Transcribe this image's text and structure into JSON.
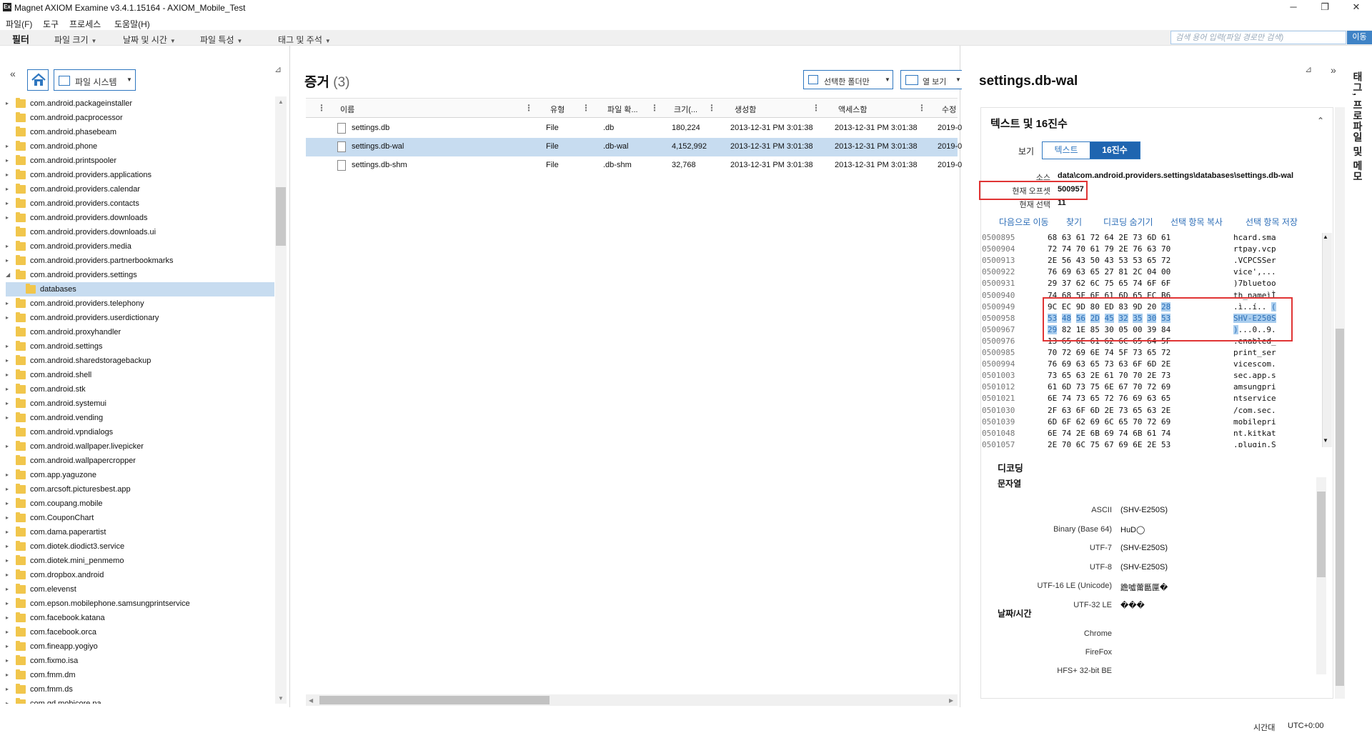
{
  "window": {
    "title": "Magnet AXIOM Examine v3.4.1.15164 - AXIOM_Mobile_Test",
    "app_icon_text": "Ex"
  },
  "menu": [
    "파일(F)",
    "도구",
    "프로세스",
    "도움말(H)"
  ],
  "filter_bar": {
    "label": "필터",
    "dropdowns": [
      "파일 크기",
      "날짜 및 시간",
      "파일 특성",
      "태그 및 주석"
    ],
    "search_placeholder": "검색 용어 입력(파일 경로만 검색)",
    "go_label": "이동"
  },
  "left_panel": {
    "source_dropdown": "파일 시스템",
    "tree": [
      {
        "label": "com.android.packageinstaller",
        "expander": "▸"
      },
      {
        "label": "com.android.pacprocessor",
        "expander": ""
      },
      {
        "label": "com.android.phasebeam",
        "expander": ""
      },
      {
        "label": "com.android.phone",
        "expander": "▸"
      },
      {
        "label": "com.android.printspooler",
        "expander": "▸"
      },
      {
        "label": "com.android.providers.applications",
        "expander": "▸"
      },
      {
        "label": "com.android.providers.calendar",
        "expander": "▸"
      },
      {
        "label": "com.android.providers.contacts",
        "expander": "▸"
      },
      {
        "label": "com.android.providers.downloads",
        "expander": "▸"
      },
      {
        "label": "com.android.providers.downloads.ui",
        "expander": ""
      },
      {
        "label": "com.android.providers.media",
        "expander": "▸"
      },
      {
        "label": "com.android.providers.partnerbookmarks",
        "expander": "▸"
      },
      {
        "label": "com.android.providers.settings",
        "expander": "◢"
      },
      {
        "label": "databases",
        "expander": "",
        "child": true
      },
      {
        "label": "com.android.providers.telephony",
        "expander": "▸"
      },
      {
        "label": "com.android.providers.userdictionary",
        "expander": "▸"
      },
      {
        "label": "com.android.proxyhandler",
        "expander": ""
      },
      {
        "label": "com.android.settings",
        "expander": "▸"
      },
      {
        "label": "com.android.sharedstoragebackup",
        "expander": "▸"
      },
      {
        "label": "com.android.shell",
        "expander": "▸"
      },
      {
        "label": "com.android.stk",
        "expander": "▸"
      },
      {
        "label": "com.android.systemui",
        "expander": "▸"
      },
      {
        "label": "com.android.vending",
        "expander": "▸"
      },
      {
        "label": "com.android.vpndialogs",
        "expander": ""
      },
      {
        "label": "com.android.wallpaper.livepicker",
        "expander": "▸"
      },
      {
        "label": "com.android.wallpapercropper",
        "expander": ""
      },
      {
        "label": "com.app.yaguzone",
        "expander": "▸"
      },
      {
        "label": "com.arcsoft.picturesbest.app",
        "expander": "▸"
      },
      {
        "label": "com.coupang.mobile",
        "expander": "▸"
      },
      {
        "label": "com.CouponChart",
        "expander": "▸"
      },
      {
        "label": "com.dama.paperartist",
        "expander": "▸"
      },
      {
        "label": "com.diotek.diodict3.service",
        "expander": "▸"
      },
      {
        "label": "com.diotek.mini_penmemo",
        "expander": "▸"
      },
      {
        "label": "com.dropbox.android",
        "expander": "▸"
      },
      {
        "label": "com.elevenst",
        "expander": "▸"
      },
      {
        "label": "com.epson.mobilephone.samsungprintservice",
        "expander": "▸"
      },
      {
        "label": "com.facebook.katana",
        "expander": "▸"
      },
      {
        "label": "com.facebook.orca",
        "expander": "▸"
      },
      {
        "label": "com.fineapp.yogiyo",
        "expander": "▸"
      },
      {
        "label": "com.fixmo.isa",
        "expander": "▸"
      },
      {
        "label": "com.fmm.dm",
        "expander": "▸"
      },
      {
        "label": "com.fmm.ds",
        "expander": "▸"
      },
      {
        "label": "com.gd.mobicore.pa",
        "expander": "▸"
      }
    ]
  },
  "center_panel": {
    "title": "증거",
    "count": "(3)",
    "folder_only_label": "선택한 폴더만",
    "column_view_label": "열 보기",
    "columns": [
      "이름",
      "유형",
      "파일 확...",
      "크기(...",
      "생성함",
      "액세스함",
      "수정"
    ],
    "rows": [
      {
        "name": "settings.db",
        "type": "File",
        "ext": ".db",
        "size": "180,224",
        "created": "2013-12-31 PM 3:01:38",
        "accessed": "2013-12-31 PM 3:01:38",
        "modified": "2019-0"
      },
      {
        "name": "settings.db-wal",
        "type": "File",
        "ext": ".db-wal",
        "size": "4,152,992",
        "created": "2013-12-31 PM 3:01:38",
        "accessed": "2013-12-31 PM 3:01:38",
        "modified": "2019-0"
      },
      {
        "name": "settings.db-shm",
        "type": "File",
        "ext": ".db-shm",
        "size": "32,768",
        "created": "2013-12-31 PM 3:01:38",
        "accessed": "2013-12-31 PM 3:01:38",
        "modified": "2019-0"
      }
    ],
    "selected_row": 1
  },
  "right_panel": {
    "title": "settings.db-wal",
    "side_tab": "태그, 프로파일 및 메모",
    "section_title": "텍스트 및 16진수",
    "view_label": "보기",
    "toggle": {
      "text": "텍스트",
      "hex": "16진수",
      "active": "hex"
    },
    "source_label": "소스",
    "source_value": "data\\com.android.providers.settings\\databases\\settings.db-wal",
    "offset_label": "현재 오프셋",
    "offset_value": "500957",
    "selection_label": "현재 선택",
    "selection_value": "11",
    "actions": [
      "다음으로 이동",
      "찾기",
      "디코딩 숨기기",
      "선택 항목 복사",
      "선택 항목 저장"
    ],
    "hex_rows": [
      {
        "offset": "0500895",
        "bytes": "68 63 61 72 64 2E 73 6D 61",
        "ascii": "hcard.sma"
      },
      {
        "offset": "0500904",
        "bytes": "72 74 70 61 79 2E 76 63 70",
        "ascii": "rtpay.vcp"
      },
      {
        "offset": "0500913",
        "bytes": "2E 56 43 50 43 53 53 65 72",
        "ascii": ".VCPCSSer"
      },
      {
        "offset": "0500922",
        "bytes": "76 69 63 65 27 81 2C 04 00",
        "ascii": "vice',..."
      },
      {
        "offset": "0500931",
        "bytes": "29 37 62 6C 75 65 74 6F 6F",
        "ascii": ")7bluetoo"
      },
      {
        "offset": "0500940",
        "bytes": "74 68 5F 6E 61 6D 65 EC B6",
        "ascii": "th_nameìÌ"
      },
      {
        "offset": "0500949",
        "bytes": "9C EC 9D 80 ED 83 9D 20 28",
        "ascii": ".ì..í.. (",
        "sel_bytes_from": 8,
        "sel_ascii_from": 8
      },
      {
        "offset": "0500958",
        "bytes": "53 48 56 2D 45 32 35 30 53",
        "ascii": "SHV-E250S",
        "sel_bytes_from": 0,
        "sel_ascii_from": 0
      },
      {
        "offset": "0500967",
        "bytes": "29 82 1E 85 30 05 00 39 84",
        "ascii": ")...0..9.",
        "sel_bytes_to": 1,
        "sel_ascii_to": 1
      },
      {
        "offset": "0500976",
        "bytes": "13 65 6E 61 62 6C 65 64 5F",
        "ascii": ".enabled_"
      },
      {
        "offset": "0500985",
        "bytes": "70 72 69 6E 74 5F 73 65 72",
        "ascii": "print_ser"
      },
      {
        "offset": "0500994",
        "bytes": "76 69 63 65 73 63 6F 6D 2E",
        "ascii": "vicescom."
      },
      {
        "offset": "0501003",
        "bytes": "73 65 63 2E 61 70 70 2E 73",
        "ascii": "sec.app.s"
      },
      {
        "offset": "0501012",
        "bytes": "61 6D 73 75 6E 67 70 72 69",
        "ascii": "amsungpri"
      },
      {
        "offset": "0501021",
        "bytes": "6E 74 73 65 72 76 69 63 65",
        "ascii": "ntservice"
      },
      {
        "offset": "0501030",
        "bytes": "2F 63 6F 6D 2E 73 65 63 2E",
        "ascii": "/com.sec."
      },
      {
        "offset": "0501039",
        "bytes": "6D 6F 62 69 6C 65 70 72 69",
        "ascii": "mobilepri"
      },
      {
        "offset": "0501048",
        "bytes": "6E 74 2E 6B 69 74 6B 61 74",
        "ascii": "nt.kitkat"
      },
      {
        "offset": "0501057",
        "bytes": "2E 70 6C 75 67 69 6E 2E 53",
        "ascii": ".plugin.S"
      }
    ],
    "decode_title": "디코딩",
    "strings_title": "문자열",
    "decodings": [
      {
        "label": "ASCII",
        "value": "(SHV-E250S)"
      },
      {
        "label": "Binary (Base 64)",
        "value": "HuD◯"
      },
      {
        "label": "UTF-7",
        "value": "(SHV-E250S)"
      },
      {
        "label": "UTF-8",
        "value": "(SHV-E250S)"
      },
      {
        "label": "UTF-16 LE (Unicode)",
        "value": "䠨噓䔭㔲匰�"
      },
      {
        "label": "UTF-32 LE",
        "value": "���"
      }
    ],
    "datetime_title": "날짜/시간",
    "datetime_rows": [
      "Chrome",
      "FireFox",
      "HFS+ 32-bit BE"
    ]
  },
  "status": {
    "tz_label": "시간대",
    "tz_value": "UTC+0:00"
  },
  "colors": {
    "accent": "#2f77c0",
    "selection": "#c7dcf0",
    "highlight_box": "#e03434",
    "folder": "#f1c64c"
  }
}
